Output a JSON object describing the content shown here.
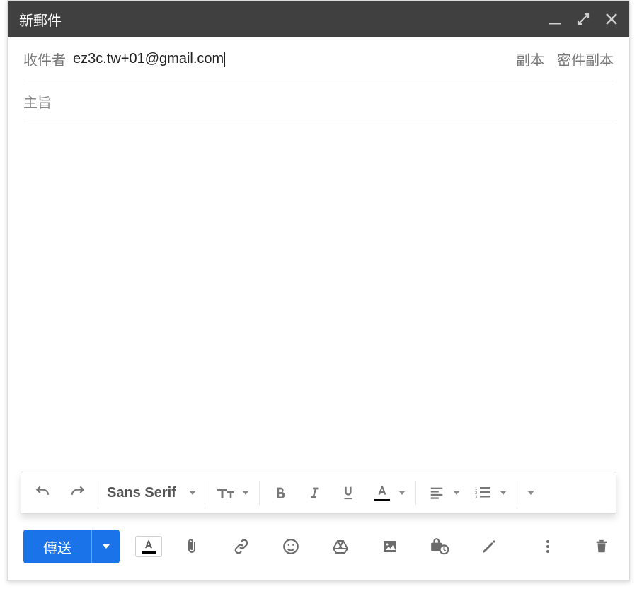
{
  "window": {
    "title": "新郵件"
  },
  "recipients": {
    "label": "收件者",
    "value": "ez3c.tw+01@gmail.com",
    "cc_label": "副本",
    "bcc_label": "密件副本"
  },
  "subject": {
    "placeholder": "主旨",
    "value": ""
  },
  "body": {
    "value": ""
  },
  "formatting": {
    "font_name": "Sans Serif",
    "buttons": {
      "undo": "undo-icon",
      "redo": "redo-icon",
      "font_size": "font-size-icon",
      "bold": "bold-icon",
      "italic": "italic-icon",
      "underline": "underline-icon",
      "text_color": "text-color-icon",
      "align": "align-icon",
      "numbered_list": "numbered-list-icon",
      "more": "more-format-icon"
    }
  },
  "actions": {
    "send_label": "傳送"
  },
  "colors": {
    "primary": "#1a73e8",
    "titlebar": "#404040",
    "icon": "#6b6b6b"
  }
}
